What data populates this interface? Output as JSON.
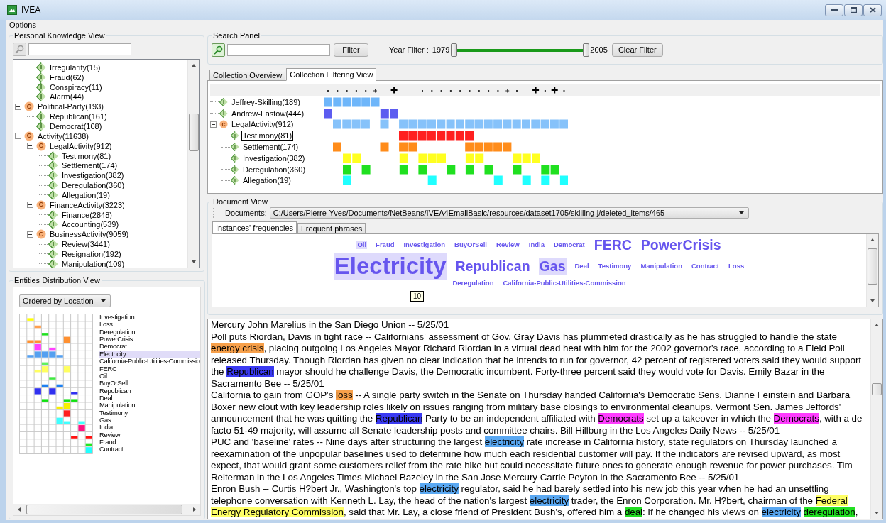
{
  "window": {
    "title": "IVEA"
  },
  "menu": [
    "Options"
  ],
  "knowledge_view": {
    "title": "Personal Knowledge View",
    "tree": [
      {
        "kind": "group",
        "children": [
          {
            "label": "Irregularity(15)",
            "kind": "instance",
            "badge": "I"
          },
          {
            "label": "Fraud(62)",
            "kind": "instance",
            "badge": "I"
          },
          {
            "label": "Conspiracy(11)",
            "kind": "instance",
            "badge": "I"
          },
          {
            "label": "Alarm(44)",
            "kind": "instance",
            "badge": "I"
          }
        ]
      },
      {
        "label": "Political-Party(193)",
        "kind": "concept",
        "badge": "C",
        "expanded": true,
        "children": [
          {
            "label": "Republican(161)",
            "kind": "instance",
            "badge": "I"
          },
          {
            "label": "Democrat(108)",
            "kind": "instance",
            "badge": "I"
          }
        ]
      },
      {
        "label": "Activity(11638)",
        "kind": "concept",
        "badge": "C",
        "expanded": true,
        "children": [
          {
            "label": "LegalActivity(912)",
            "kind": "concept",
            "badge": "C",
            "expanded": true,
            "children": [
              {
                "label": "Testimony(81)",
                "kind": "instance",
                "badge": "I"
              },
              {
                "label": "Settlement(174)",
                "kind": "instance",
                "badge": "I"
              },
              {
                "label": "Investigation(382)",
                "kind": "instance",
                "badge": "I"
              },
              {
                "label": "Deregulation(360)",
                "kind": "instance",
                "badge": "I"
              },
              {
                "label": "Allegation(19)",
                "kind": "instance",
                "badge": "I"
              }
            ]
          },
          {
            "label": "FinanceActivity(3223)",
            "kind": "concept",
            "badge": "C",
            "expanded": true,
            "children": [
              {
                "label": "Finance(2848)",
                "kind": "instance",
                "badge": "I"
              },
              {
                "label": "Accounting(539)",
                "kind": "instance",
                "badge": "I"
              }
            ]
          },
          {
            "label": "BusinessActivity(9059)",
            "kind": "concept",
            "badge": "C",
            "expanded": true,
            "children": [
              {
                "label": "Review(3441)",
                "kind": "instance",
                "badge": "I"
              },
              {
                "label": "Resignation(192)",
                "kind": "instance",
                "badge": "I"
              },
              {
                "label": "Manipulation(109)",
                "kind": "instance",
                "badge": "I"
              }
            ]
          }
        ]
      }
    ]
  },
  "distribution_view": {
    "title": "Entities Distribution View",
    "order": "Ordered by Location",
    "entities": [
      {
        "label": "Investigation",
        "color": "#ffff00",
        "selected": false
      },
      {
        "label": "Loss",
        "color": "#ffa050",
        "selected": false
      },
      {
        "label": "Deregulation",
        "color": "#20e020",
        "selected": false
      },
      {
        "label": "PowerCrisis",
        "color": "#ff9030",
        "selected": false
      },
      {
        "label": "Democrat",
        "color": "#ff40ff",
        "selected": false
      },
      {
        "label": "Electricity",
        "color": "#55a0f0",
        "selected": true
      },
      {
        "label": "California-Public-Utilities-Commissio",
        "color": "#60f060",
        "selected": false
      },
      {
        "label": "FERC",
        "color": "#ffff60",
        "selected": false
      },
      {
        "label": "Oil",
        "color": "#40e840",
        "selected": false
      },
      {
        "label": "BuyOrSell",
        "color": "#1e80f0",
        "selected": false
      },
      {
        "label": "Republican",
        "color": "#3030f0",
        "selected": false
      },
      {
        "label": "Deal",
        "color": "#10e010",
        "selected": false
      },
      {
        "label": "Manipulation",
        "color": "#f8f000",
        "selected": false
      },
      {
        "label": "Testimony",
        "color": "#ff2020",
        "selected": false
      },
      {
        "label": "Gas",
        "color": "#40ffff",
        "selected": false
      },
      {
        "label": "India",
        "color": "#ff1080",
        "selected": false
      },
      {
        "label": "Review",
        "color": "#ff1010",
        "selected": false
      },
      {
        "label": "Fraud",
        "color": "#22e822",
        "selected": false
      },
      {
        "label": "Contract",
        "color": "#20ffff",
        "selected": false
      }
    ]
  },
  "search_panel": {
    "title": "Search Panel",
    "filter_button": "Filter",
    "year_filter": {
      "label": "Year Filter :",
      "min": "1979",
      "max": "2005",
      "level": 1
    },
    "clear_button": "Clear Filter"
  },
  "collection_tabs": [
    {
      "label": "Collection Overview",
      "selected": false
    },
    {
      "label": "Collection Filtering View",
      "selected": true
    }
  ],
  "filtering_view": {
    "rows": [
      {
        "label": "Jeffrey-Skilling(189)",
        "kind": "instance",
        "badge": "I",
        "color": "#6eb6fa",
        "selected": false
      },
      {
        "label": "Andrew-Fastow(444)",
        "kind": "instance",
        "badge": "I",
        "color": "#5c5cf0",
        "selected": false
      },
      {
        "label": "LegalActivity(912)",
        "kind": "concept",
        "badge": "C",
        "expanded": true,
        "color": "#86c2fa",
        "selected": false,
        "children": [
          {
            "label": "Testimony(81)",
            "kind": "instance",
            "badge": "I",
            "color": "#ff2020",
            "selected": true
          },
          {
            "label": "Settlement(174)",
            "kind": "instance",
            "badge": "I",
            "color": "#ff8c1a",
            "selected": false
          },
          {
            "label": "Investigation(382)",
            "kind": "instance",
            "badge": "I",
            "color": "#ffff20",
            "selected": false
          },
          {
            "label": "Deregulation(360)",
            "kind": "instance",
            "badge": "I",
            "color": "#20e020",
            "selected": false
          },
          {
            "label": "Allegation(19)",
            "kind": "instance",
            "badge": "I",
            "color": "#20ffff",
            "selected": false
          }
        ]
      }
    ]
  },
  "document_view": {
    "title": "Document View",
    "documents_label": "Documents:",
    "document_path": "C:/Users/Pierre-Yves/Documents/NetBeans/IVEA4EmailBasic/resources/dataset1705/skilling-j/deleted_items/465",
    "tabs": [
      {
        "label": "Instances' frequencies",
        "selected": true
      },
      {
        "label": "Frequent phrases",
        "selected": false
      }
    ],
    "cloud": {
      "tooltip": "10",
      "lines": [
        [
          {
            "text": "Oil",
            "kind": "small",
            "selected": true
          },
          {
            "text": "Fraud",
            "kind": "small",
            "selected": false
          },
          {
            "text": "Investigation",
            "kind": "small",
            "selected": false
          },
          {
            "text": "BuyOrSell",
            "kind": "small",
            "selected": false
          },
          {
            "text": "Review",
            "kind": "small",
            "selected": false
          },
          {
            "text": "India",
            "kind": "small",
            "selected": false
          },
          {
            "text": "Democrat",
            "kind": "small",
            "selected": false
          },
          {
            "text": "FERC",
            "kind": "large",
            "selected": false
          },
          {
            "text": "PowerCrisis",
            "kind": "large",
            "selected": false
          }
        ],
        [
          {
            "text": "Electricity",
            "kind": "huge",
            "selected": true
          },
          {
            "text": "Republican",
            "kind": "large",
            "selected": false
          },
          {
            "text": "Gas",
            "kind": "large",
            "selected": true
          },
          {
            "text": "Deal",
            "kind": "small",
            "selected": false
          },
          {
            "text": "Testimony",
            "kind": "small",
            "selected": false
          },
          {
            "text": "Manipulation",
            "kind": "small",
            "selected": false
          },
          {
            "text": "Contract",
            "kind": "small",
            "selected": false
          },
          {
            "text": "Loss",
            "kind": "small",
            "selected": false
          }
        ],
        [
          {
            "text": "Deregulation",
            "kind": "small",
            "selected": false
          },
          {
            "text": "California-Public-Utilities-Commission",
            "kind": "small",
            "selected": false
          }
        ]
      ]
    },
    "text": [
      [
        {
          "text": "Mercury John Marelius in the San Diego Union -- 5/25/01"
        }
      ],
      [
        {
          "text": "Poll puts Riordan, Davis in tight race -- Californians' assessment of Gov. Gray Davis has plummeted drastically as he has struggled to handle the state "
        },
        {
          "text": "energy crisis",
          "color": "#f7a04a"
        },
        {
          "text": ", placing outgoing Los Angeles Mayor Richard Riordan in a virtual dead heat with him for the 2002 governor's race, according to a Field Poll released Thursday. Though Riordan has given no clear indication that he intends to run for governor, 42 percent of registered voters said they would support the "
        },
        {
          "text": "Republican",
          "color": "#3a3af2"
        },
        {
          "text": " mayor should he challenge Davis, the Democratic incumbent. Forty-three percent said they would vote for Davis. Emily Bazar in the Sacramento Bee -- 5/25/01"
        }
      ],
      [
        {
          "text": "California to gain from GOP's "
        },
        {
          "text": "loss",
          "color": "#f7a04a"
        },
        {
          "text": " -- A single party switch in the Senate on Thursday handed California's Democratic Sens. Dianne Feinstein and Barbara Boxer new clout with key leadership roles likely on issues ranging from military base closings to environmental cleanups. Vermont Sen. James Jeffords' announcement that he was quitting the "
        },
        {
          "text": "Republican",
          "color": "#3a3af2"
        },
        {
          "text": " Party to be an independent affiliated with "
        },
        {
          "text": "Democrats",
          "color": "#ff3cff"
        },
        {
          "text": " set up a takeover in which the "
        },
        {
          "text": "Democrats",
          "color": "#ff3cff"
        },
        {
          "text": ", with a de facto 51-49 majority, will assume all Senate leadership posts and committee chairs. Bill Hillburg in the Los Angeles Daily News -- 5/25/01"
        }
      ],
      [
        {
          "text": "PUC and 'baseline' rates -- Nine days after structuring the largest "
        },
        {
          "text": "electricity",
          "color": "#5aa8f2"
        },
        {
          "text": " rate increase in California history, state regulators on Thursday launched a reexamination of the unpopular baselines used to determine how much each residential customer will pay. If the indicators are revised upward, as most expect, that would grant some customers relief from the rate hike but could necessitate future ones to generate enough revenue for power purchases. Tim Reiterman in the Los Angeles Times Michael Bazeley in the San Jose Mercury Carrie Peyton in the Sacramento Bee -- 5/25/01"
        }
      ],
      [
        {
          "text": "Enron Bush -- Curtis H?bert Jr., Washington's top "
        },
        {
          "text": "electricity",
          "color": "#5aa8f2"
        },
        {
          "text": " regulator, said he had barely settled into his new job this year when he had an unsettling telephone conversation with Kenneth L. Lay, the head of the nation's largest "
        },
        {
          "text": "electricity",
          "color": "#5aa8f2"
        },
        {
          "text": " trader, the Enron Corporation. Mr. H?bert, chairman of the "
        },
        {
          "text": "Federal Energy Regulatory Commission",
          "color": "#ffff66"
        },
        {
          "text": ", said that Mr. Lay, a close friend of President Bush's, offered him a "
        },
        {
          "text": "deal",
          "color": "#22e022"
        },
        {
          "text": ": If he changed his views on "
        },
        {
          "text": "electricity",
          "color": "#5aa8f2"
        },
        {
          "text": "deregulation",
          "color": "#22e022"
        },
        {
          "text": ","
        }
      ]
    ]
  }
}
